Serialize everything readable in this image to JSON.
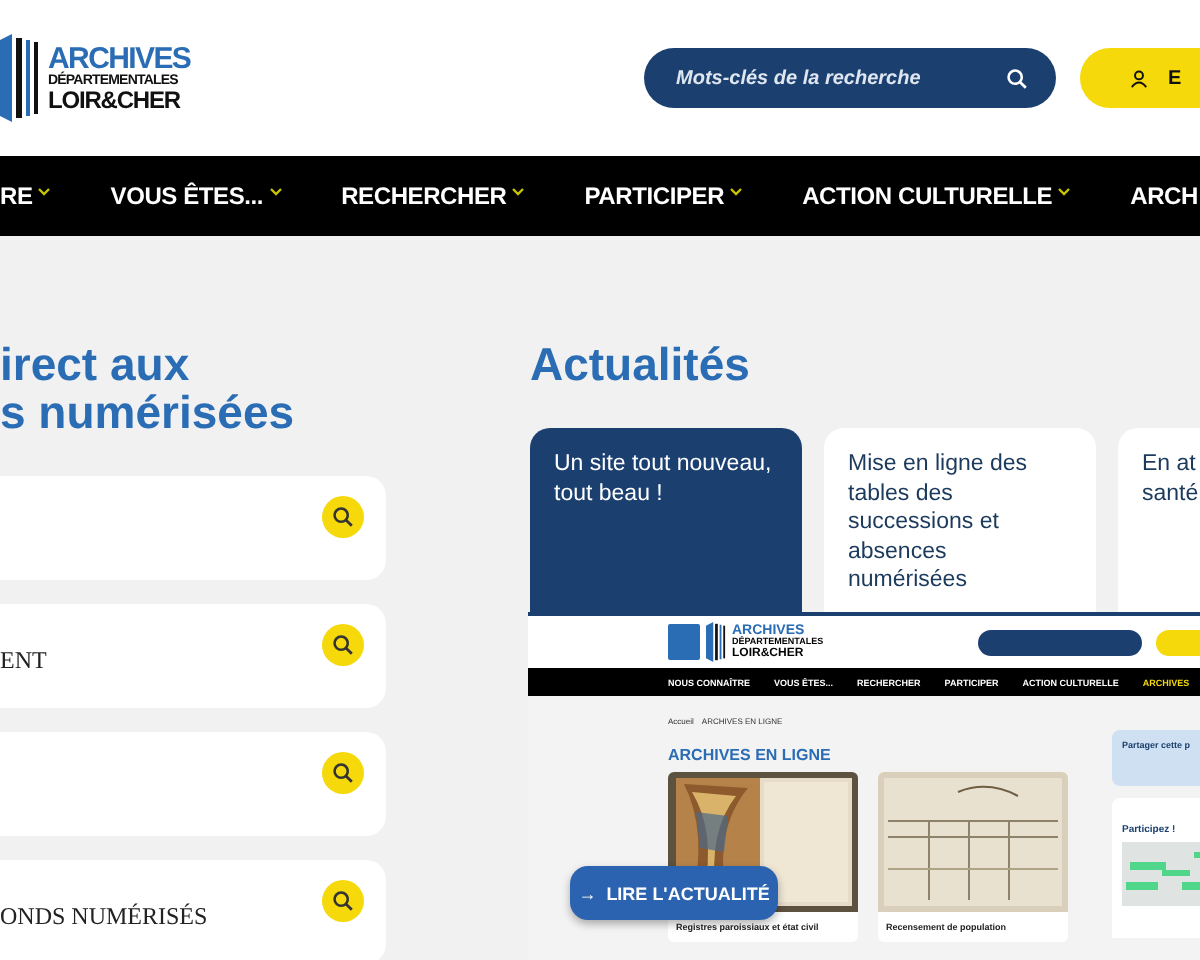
{
  "header": {
    "logo": {
      "title": "ARCHIVES",
      "subtitle": "DÉPARTEMENTALES",
      "place": "LOIR&CHER"
    },
    "search": {
      "placeholder": "Mots-clés de la recherche"
    },
    "account_button": {
      "label": "E"
    }
  },
  "nav": [
    {
      "label": "RE",
      "has_menu": true
    },
    {
      "label": "VOUS ÊTES...",
      "has_menu": true
    },
    {
      "label": "RECHERCHER",
      "has_menu": true
    },
    {
      "label": "PARTICIPER",
      "has_menu": true
    },
    {
      "label": "ACTION CULTURELLE",
      "has_menu": true
    },
    {
      "label": "ARCH",
      "has_menu": false
    }
  ],
  "direct_access": {
    "heading": [
      "irect aux",
      "s numérisées"
    ],
    "items": [
      {
        "kind": "icon_only"
      },
      {
        "kind": "labelled",
        "label": "ENT"
      },
      {
        "kind": "icon_only"
      },
      {
        "kind": "labelled",
        "label": "ONDS NUMÉRISÉS"
      }
    ]
  },
  "news": {
    "heading": "Actualités",
    "cards": [
      {
        "title": "Un site tout nouveau, tout beau !",
        "featured": true
      },
      {
        "title": "Mise en ligne des tables des successions et absences numérisées",
        "featured": false
      },
      {
        "title": "En at\nsanté",
        "featured": false
      }
    ],
    "preview": {
      "logo": {
        "title": "ARCHIVES",
        "subtitle": "DÉPARTEMENTALES",
        "place": "LOIR&CHER"
      },
      "nav": [
        {
          "label": "NOUS CONNAÎTRE",
          "selected": false
        },
        {
          "label": "VOUS ÊTES...",
          "selected": false
        },
        {
          "label": "RECHERCHER",
          "selected": false
        },
        {
          "label": "PARTICIPER",
          "selected": false
        },
        {
          "label": "ACTION CULTURELLE",
          "selected": false
        },
        {
          "label": "ARCHIVES",
          "selected": true
        }
      ],
      "breadcrumb": [
        "Accueil",
        "ARCHIVES EN LIGNE"
      ],
      "heading": "ARCHIVES EN LIGNE",
      "items": [
        {
          "caption": "Registres paroissiaux et état civil"
        },
        {
          "caption": "Recensement de population"
        }
      ],
      "share": {
        "title": "Partager cette p"
      },
      "sidebar_card": {
        "title": "Participez !"
      }
    },
    "read_button": {
      "label": "LIRE L'ACTUALITÉ",
      "icon": "→"
    }
  }
}
